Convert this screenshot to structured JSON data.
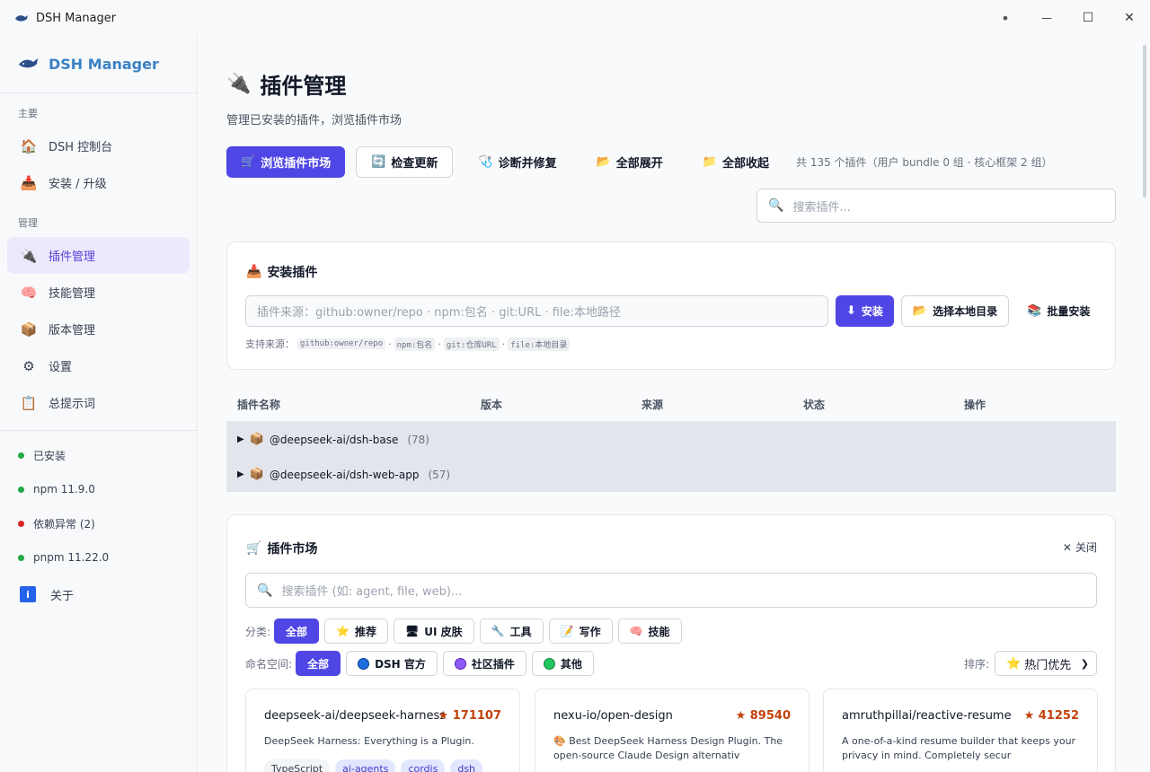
{
  "window": {
    "title": "DSH Manager",
    "controls": {
      "dot": "•",
      "minimize": "—",
      "maximize": "☐",
      "close": "✕"
    }
  },
  "sidebar": {
    "brand": "DSH Manager",
    "section_main": "主要",
    "main_items": [
      {
        "label": "DSH 控制台",
        "icon": "home-icon"
      },
      {
        "label": "安装 / 升级",
        "icon": "install-icon"
      }
    ],
    "section_manage": "管理",
    "manage_items": [
      {
        "label": "插件管理",
        "icon": "plug-icon",
        "active": true
      },
      {
        "label": "技能管理",
        "icon": "brain-icon"
      },
      {
        "label": "版本管理",
        "icon": "package-icon"
      },
      {
        "label": "设置",
        "icon": "gear-icon"
      },
      {
        "label": "总提示词",
        "icon": "clipboard-icon"
      }
    ],
    "status": [
      {
        "label": "已安装",
        "color": "#22a845"
      },
      {
        "label": "npm 11.9.0",
        "color": "#22a845"
      },
      {
        "label": "依赖异常 (2)",
        "color": "#dc2626"
      },
      {
        "label": "pnpm 11.22.0",
        "color": "#22a845"
      }
    ],
    "about": "关于",
    "about_icon_text": "i"
  },
  "page": {
    "title": "插件管理",
    "subtitle": "管理已安装的插件，浏览插件市场",
    "toolbar": {
      "browse_market": "浏览插件市场",
      "check_updates": "检查更新",
      "diagnose": "诊断并修复",
      "expand_all": "全部展开",
      "collapse_all": "全部收起",
      "count": "共 135 个插件（用户 bundle 0 组 · 核心框架 2 组）"
    },
    "search_placeholder": "搜索插件..."
  },
  "install": {
    "title": "安装插件",
    "source_placeholder": "插件来源：github:owner/repo · npm:包名 · git:URL · file:本地路径",
    "install_button": "安装",
    "choose_dir": "选择本地目录",
    "batch_install": "批量安装",
    "hint_label": "支持来源：",
    "hint_sources": [
      "github:owner/repo",
      "npm:包名",
      "git:仓库URL",
      "file:本地目录"
    ],
    "hint_sep": "·"
  },
  "table": {
    "columns": [
      "插件名称",
      "版本",
      "来源",
      "状态",
      "操作"
    ],
    "groups": [
      {
        "name": "@deepseek-ai/dsh-base",
        "count": "(78)"
      },
      {
        "name": "@deepseek-ai/dsh-web-app",
        "count": "(57)"
      }
    ]
  },
  "market": {
    "title": "插件市场",
    "close": "关闭",
    "search_placeholder": "搜索插件 (如: agent, file, web)...",
    "category_label": "分类:",
    "categories": [
      {
        "label": "全部",
        "icon": "",
        "active": true
      },
      {
        "label": "推荐",
        "icon": "star-icon"
      },
      {
        "label": "UI 皮肤",
        "icon": "monitor-icon"
      },
      {
        "label": "工具",
        "icon": "wrench-icon"
      },
      {
        "label": "写作",
        "icon": "memo-icon"
      },
      {
        "label": "技能",
        "icon": "brain-icon"
      }
    ],
    "namespace_label": "命名空间:",
    "namespaces": [
      {
        "label": "全部",
        "color": "",
        "active": true
      },
      {
        "label": "DSH 官方",
        "color": "#1d6fe0"
      },
      {
        "label": "社区插件",
        "color": "#8b5cf6"
      },
      {
        "label": "其他",
        "color": "#22c55e"
      }
    ],
    "sort_label": "排序:",
    "sort_value": "热门优先",
    "plugins": [
      {
        "name": "deepseek-ai/deepseek-harness",
        "stars": "★ 171107",
        "desc": "DeepSeek Harness: Everything is a Plugin.",
        "tags": [
          "TypeScript",
          "ai-agents",
          "cordis",
          "dsh"
        ]
      },
      {
        "name": "nexu-io/open-design",
        "stars": "★ 89540",
        "desc": "Best DeepSeek Harness Design Plugin. The open-source Claude Design alternativ",
        "tags": []
      },
      {
        "name": "amruthpillai/reactive-resume",
        "stars": "★ 41252",
        "desc": "A one-of-a-kind resume builder that keeps your privacy in mind. Completely secur",
        "tags": []
      }
    ]
  }
}
